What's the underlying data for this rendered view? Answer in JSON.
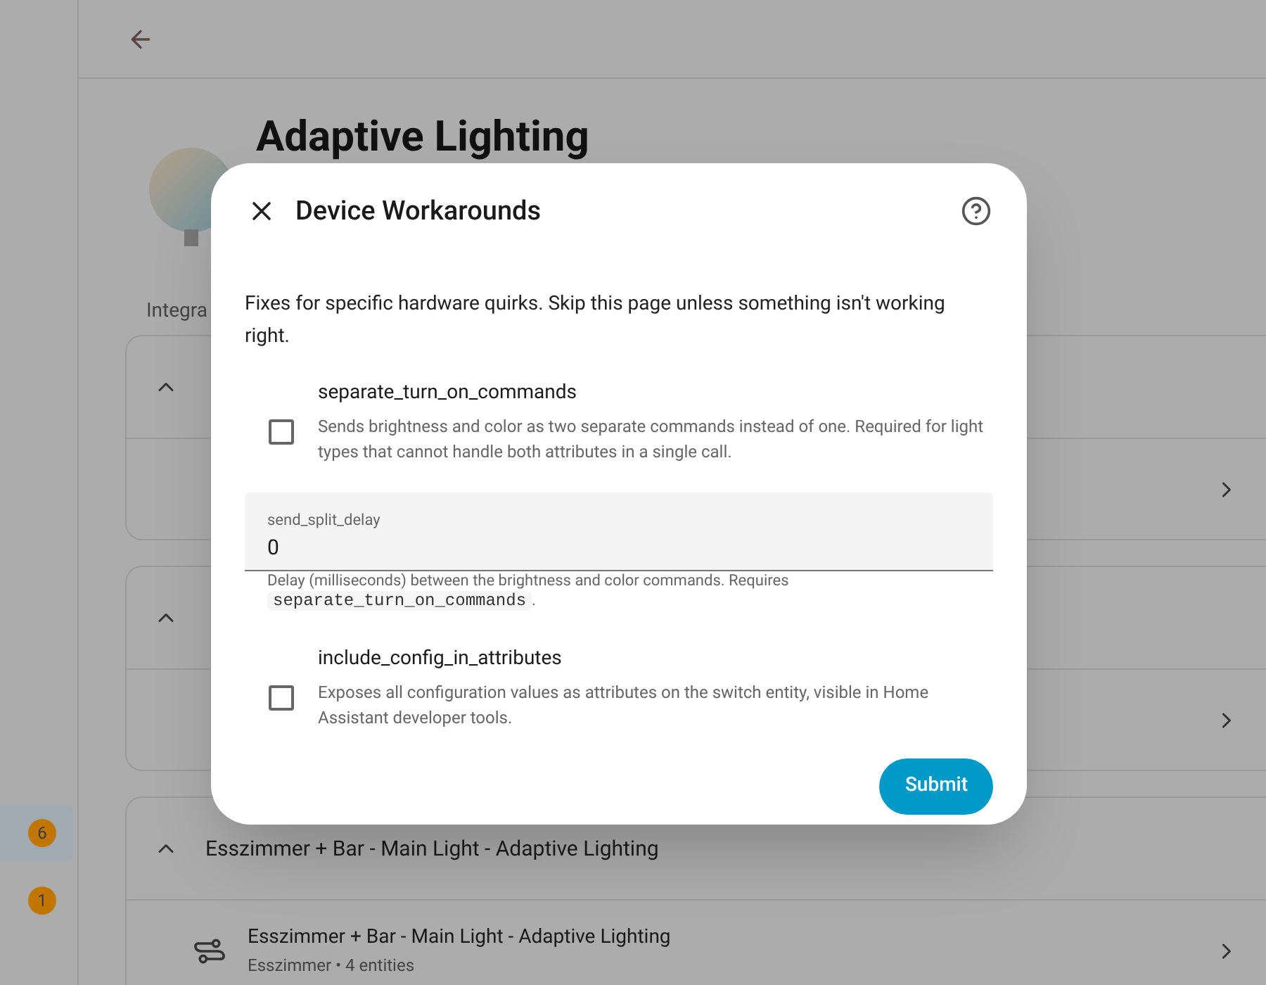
{
  "sidebar": {
    "badges": [
      {
        "count": "6",
        "selected": true
      },
      {
        "count": "1",
        "selected": false
      }
    ]
  },
  "page": {
    "title": "Adaptive Lighting",
    "section_label": "Integra",
    "cards": [
      {
        "expanded": true,
        "rows": [
          {}
        ]
      },
      {
        "expanded": true,
        "rows": [
          {}
        ]
      },
      {
        "header": "Esszimmer + Bar - Main Light - Adaptive Lighting",
        "expanded": true,
        "rows": [
          {
            "title": "Esszimmer + Bar - Main Light - Adaptive Lighting",
            "subtitle": "Esszimmer • 4 entities"
          }
        ]
      }
    ]
  },
  "dialog": {
    "title": "Device Workarounds",
    "description": "Fixes for specific hardware quirks. Skip this page unless something isn't working right.",
    "options": [
      {
        "kind": "checkbox",
        "label": "separate_turn_on_commands",
        "description": "Sends brightness and color as two separate commands instead of one. Required for light types that cannot handle both attributes in a single call.",
        "checked": false
      },
      {
        "kind": "number",
        "label": "send_split_delay",
        "value": "0",
        "helper": "Delay (milliseconds) between the brightness and color commands. Requires",
        "helper_code": "separate_turn_on_commands",
        "helper_end": "."
      },
      {
        "kind": "checkbox",
        "label": "include_config_in_attributes",
        "description": "Exposes all configuration values as attributes on the switch entity, visible in Home Assistant developer tools.",
        "checked": false
      }
    ],
    "submit": "Submit"
  }
}
